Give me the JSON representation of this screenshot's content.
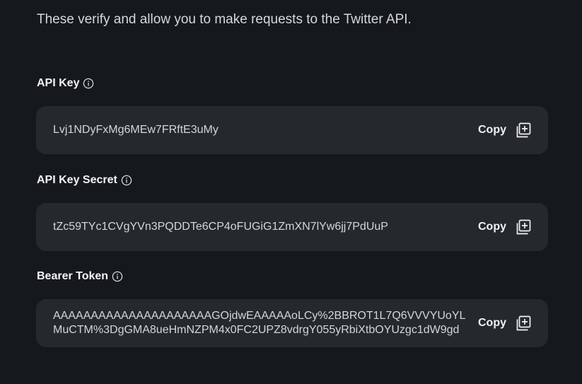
{
  "intro": "These verify and allow you to make requests to the Twitter API.",
  "fields": [
    {
      "label": "API Key",
      "value": "Lvj1NDyFxMg6MEw7FRftE3uMy",
      "copy_label": "Copy",
      "info_icon": "info-icon",
      "copy_icon": "copy-icon"
    },
    {
      "label": "API Key Secret",
      "value": "tZc59TYc1CVgYVn3PQDDTe6CP4oFUGiG1ZmXN7lYw6jj7PdUuP",
      "copy_label": "Copy",
      "info_icon": "info-icon",
      "copy_icon": "copy-icon"
    },
    {
      "label": "Bearer Token",
      "value": "AAAAAAAAAAAAAAAAAAAAAGOjdwEAAAAAoLCy%2BBROT1L7Q6VVVYUoYLMuCTM%3DgGMA8ueHmNZPM4x0FC2UPZ8vdrgY055yRbiXtbOYUzgc1dW9gd",
      "copy_label": "Copy",
      "info_icon": "info-icon",
      "copy_icon": "copy-icon"
    }
  ],
  "colors": {
    "background": "#15181c",
    "box": "#25292e",
    "text": "#e7e9ea"
  }
}
